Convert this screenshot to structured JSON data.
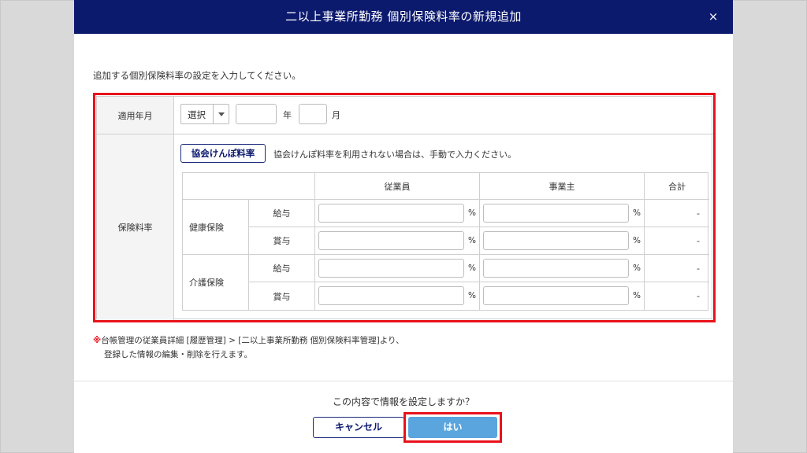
{
  "dialog": {
    "title": "二以上事業所勤務 個別保険料率の新規追加",
    "close_icon": "×",
    "intro": "追加する個別保険料率の設定を入力してください。"
  },
  "form": {
    "date_row": {
      "label": "適用年月",
      "select_value": "選択",
      "year_value": "",
      "year_unit": "年",
      "month_value": "",
      "month_unit": "月"
    },
    "rate_row": {
      "label": "保険料率",
      "kyokai_button": "協会けんぽ料率",
      "kyokai_note": "協会けんぽ料率を利用されない場合は、手動で入力ください。",
      "headers": {
        "employee": "従業員",
        "employer": "事業主",
        "total": "合計"
      },
      "percent_unit": "%",
      "groups": [
        {
          "name": "健康保険",
          "rows": [
            {
              "type": "給与",
              "employee": "",
              "employer": "",
              "total": "-"
            },
            {
              "type": "賞与",
              "employee": "",
              "employer": "",
              "total": "-"
            }
          ]
        },
        {
          "name": "介護保険",
          "rows": [
            {
              "type": "給与",
              "employee": "",
              "employer": "",
              "total": "-"
            },
            {
              "type": "賞与",
              "employee": "",
              "employer": "",
              "total": "-"
            }
          ]
        }
      ]
    }
  },
  "footnote": {
    "mark": "※",
    "line1": "台帳管理の従業員詳細 [履歴管理] > [二以上事業所勤務 個別保険料率管理]より、",
    "line2": "登録した情報の編集・削除を行えます。"
  },
  "confirm": {
    "question": "この内容で情報を設定しますか？",
    "cancel_label": "キャンセル",
    "yes_label": "はい"
  },
  "colors": {
    "header_bg": "#0c1a6e",
    "highlight": "#e8121b",
    "primary_button": "#5aa5de"
  }
}
